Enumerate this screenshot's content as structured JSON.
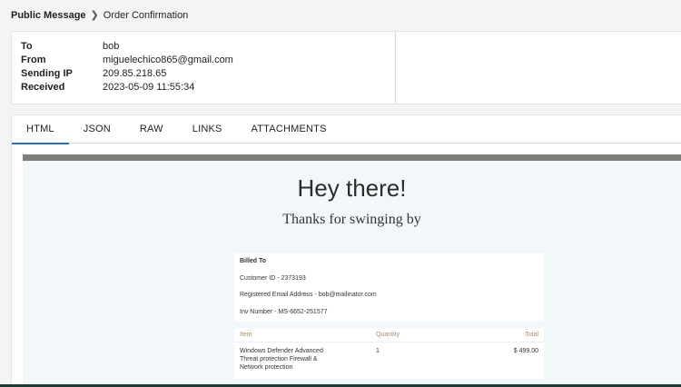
{
  "breadcrumb": {
    "root": "Public Message",
    "current": "Order Confirmation"
  },
  "headers": [
    {
      "key": "To",
      "value": "bob"
    },
    {
      "key": "From",
      "value": "miguelechico865@gmail.com"
    },
    {
      "key": "Sending IP",
      "value": "209.85.218.65"
    },
    {
      "key": "Received",
      "value": "2023-05-09 11:55:34"
    }
  ],
  "tabs": [
    "HTML",
    "JSON",
    "RAW",
    "LINKS",
    "ATTACHMENTS"
  ],
  "active_tab": "HTML",
  "email": {
    "title": "Hey there!",
    "subtitle": "Thanks for swinging by",
    "billed": {
      "heading": "Billed To",
      "customer_id": "Customer ID - 2373193",
      "email": "Registered Email Address - bob@mailinator.com",
      "invoice": "Inv Number - MS-6652-251577"
    },
    "items_table": {
      "headers": {
        "item": "Item",
        "quantity": "Quantity",
        "total": "Total"
      },
      "rows": [
        {
          "item": "Windows Defender Advanced Threat protection Firewall & Network protection",
          "quantity": "1",
          "total": "$ 499.00"
        }
      ]
    }
  },
  "colors": {
    "accent": "#2a6ebb",
    "preview_bg": "#f2f8fa",
    "topbar": "#7d7d7a"
  }
}
